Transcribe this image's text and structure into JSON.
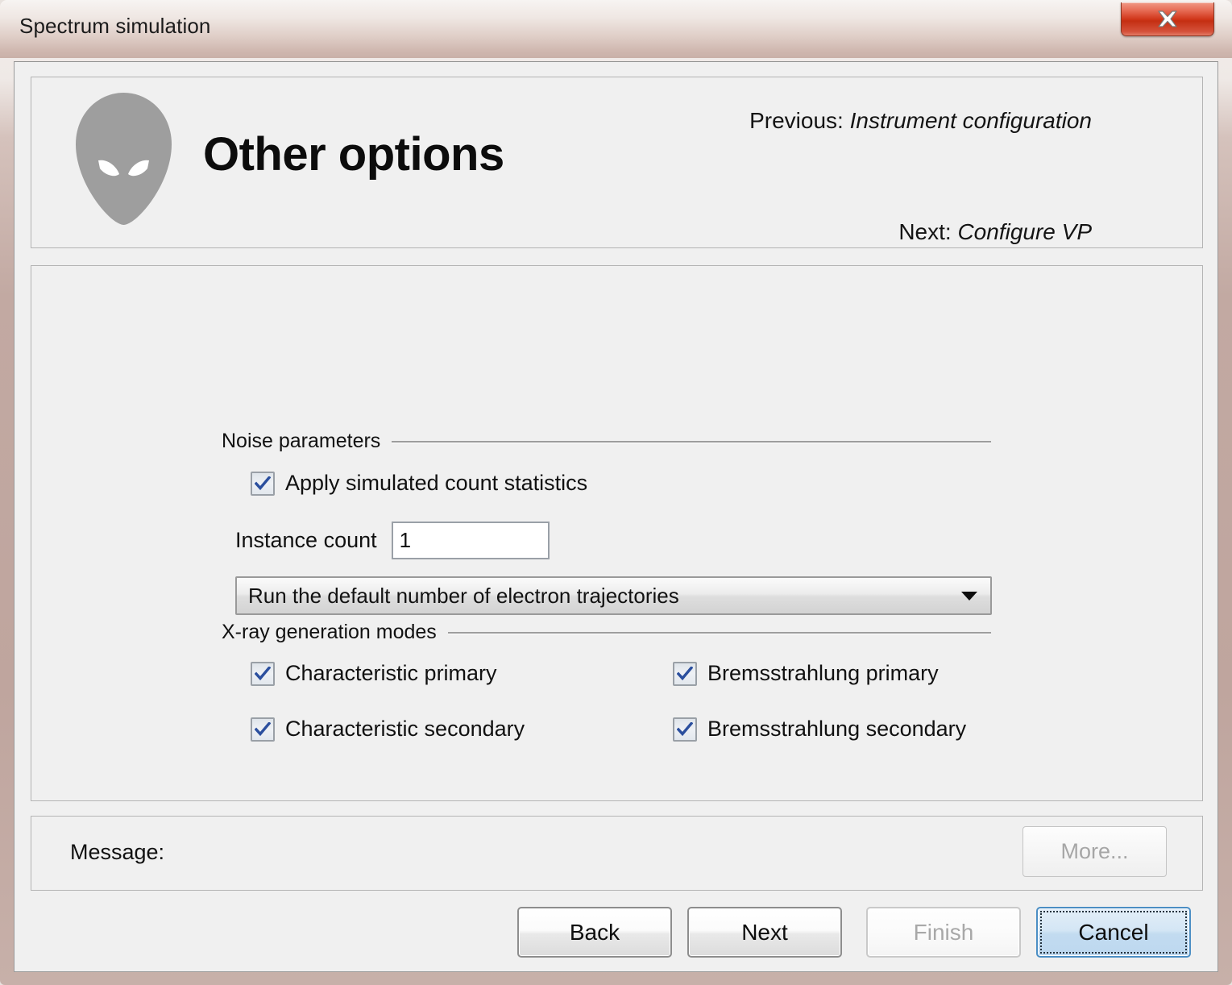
{
  "window": {
    "title": "Spectrum simulation",
    "close_icon": "close-icon",
    "close_label": "X"
  },
  "header": {
    "icon": "alien-head-icon",
    "page_title": "Other options",
    "previous_prefix": "Previous:",
    "previous_value": "Instrument configuration",
    "next_prefix": "Next:",
    "next_value": "Configure VP"
  },
  "noise_group": {
    "label": "Noise parameters",
    "apply_count_statistics": {
      "label": "Apply simulated count statistics",
      "checked": true
    },
    "instance_count": {
      "label": "Instance count",
      "value": "1",
      "placeholder": ""
    },
    "trajectories_select": {
      "selected": "Run the default number of electron trajectories",
      "arrow_icon": "chevron-down-icon"
    }
  },
  "xray_group": {
    "label": "X-ray generation modes",
    "options": [
      {
        "label": "Characteristic primary",
        "checked": true
      },
      {
        "label": "Bremsstrahlung primary",
        "checked": true
      },
      {
        "label": "Characteristic secondary",
        "checked": true
      },
      {
        "label": "Bremsstrahlung secondary",
        "checked": true
      }
    ]
  },
  "message_bar": {
    "label": "Message:",
    "value": "",
    "more_button": "More...",
    "more_disabled": true
  },
  "footer": {
    "back": "Back",
    "next": "Next",
    "finish": "Finish",
    "finish_disabled": true,
    "cancel": "Cancel",
    "cancel_focused": true
  },
  "colors": {
    "titlebar_accent": "#c9b0a8",
    "close_red": "#cf3418",
    "panel_bg": "#f0f0f0",
    "focus_blue": "#4b8ec4",
    "check_blue": "#2b4f9e"
  }
}
